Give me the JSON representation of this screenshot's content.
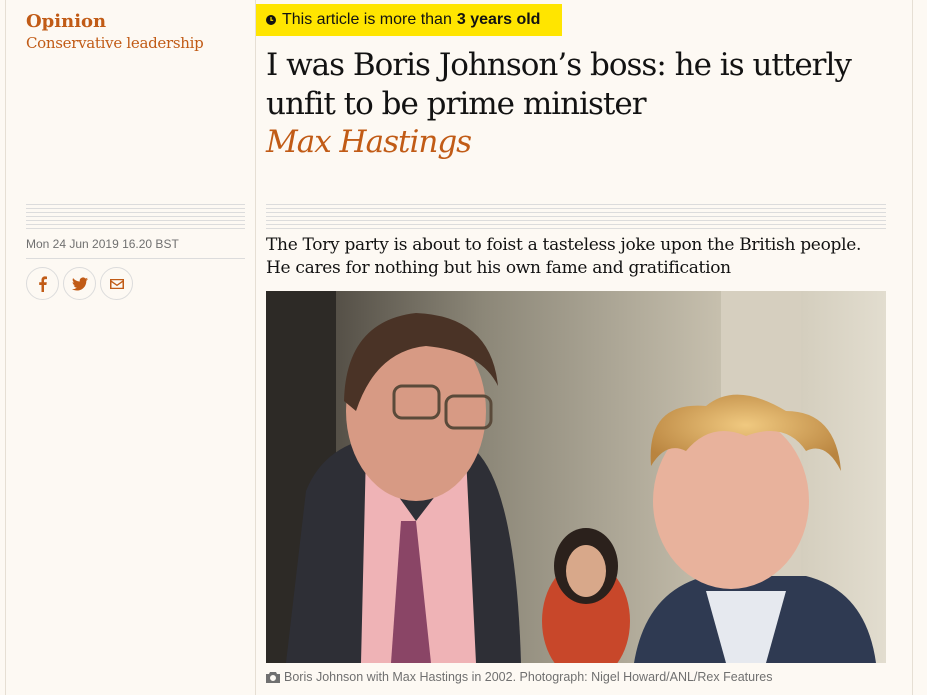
{
  "section": {
    "label": "Opinion",
    "series": "Conservative leadership"
  },
  "age_warning": {
    "prefix": "This article is more than",
    "age": "3 years old"
  },
  "article": {
    "headline": "I was Boris Johnson’s boss: he is utterly unfit to be prime minister",
    "byline": "Max Hastings",
    "standfirst": "The Tory party is about to foist a tasteless joke upon the British people. He cares for nothing but his own fame and gratification",
    "date": "Mon 24 Jun 2019 16.20 BST",
    "image_caption": "Boris Johnson with Max Hastings in 2002. Photograph: Nigel Howard/ANL/Rex Features"
  },
  "share": [
    {
      "icon": "facebook-icon"
    },
    {
      "icon": "twitter-icon"
    },
    {
      "icon": "email-icon"
    }
  ],
  "colors": {
    "accent": "#c15b16",
    "background": "#fdf9f3",
    "warning": "#ffe500"
  }
}
